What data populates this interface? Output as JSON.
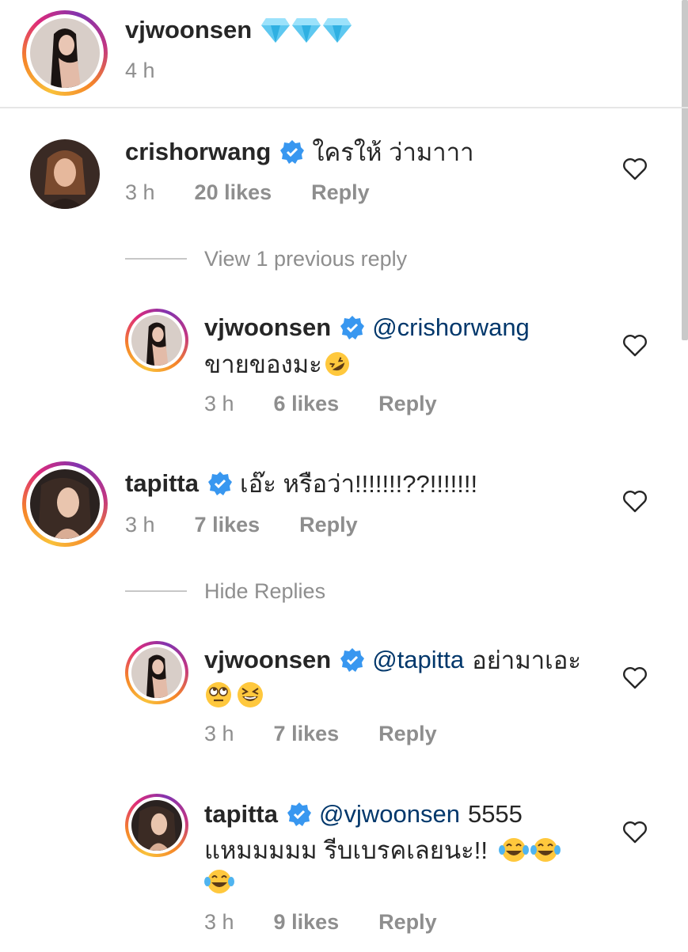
{
  "caption": {
    "username": "vjwoonsen",
    "emoji_text": "💎💎💎",
    "time": "4 h"
  },
  "comments": [
    {
      "username": "crishorwang",
      "text": "ใครให้ ว่ามาาา",
      "time": "3 h",
      "likes": "20 likes",
      "reply": "Reply",
      "thread_link": "View 1 previous reply",
      "replies": [
        {
          "username": "vjwoonsen",
          "mention": "@crishorwang",
          "text_line2": "ขายของมะ",
          "time": "3 h",
          "likes": "6 likes",
          "reply": "Reply"
        }
      ]
    },
    {
      "username": "tapitta",
      "text": "เอ๊ะ หรือว่า!!!!!!!??!!!!!!!",
      "time": "3 h",
      "likes": "7 likes",
      "reply": "Reply",
      "thread_link": "Hide Replies",
      "replies": [
        {
          "username": "vjwoonsen",
          "mention": "@tapitta",
          "text": "อย่ามาเอะ",
          "time": "3 h",
          "likes": "7 likes",
          "reply": "Reply"
        },
        {
          "username": "tapitta",
          "mention": "@vjwoonsen",
          "text": "5555",
          "text_line2": "แหมมมมม รีบเบรคเลยนะ!!",
          "time": "3 h",
          "likes": "9 likes",
          "reply": "Reply"
        }
      ]
    }
  ],
  "colors": {
    "verified": "#3897f0",
    "mention": "#00376b",
    "meta": "#8e8e8e",
    "text": "#262626"
  },
  "icons": [
    "verified-badge-icon",
    "heart-icon",
    "diamond-icon",
    "rofl-emoji-icon",
    "eye-roll-emoji-icon",
    "grinning-squint-emoji-icon",
    "tears-of-joy-emoji-icon"
  ]
}
